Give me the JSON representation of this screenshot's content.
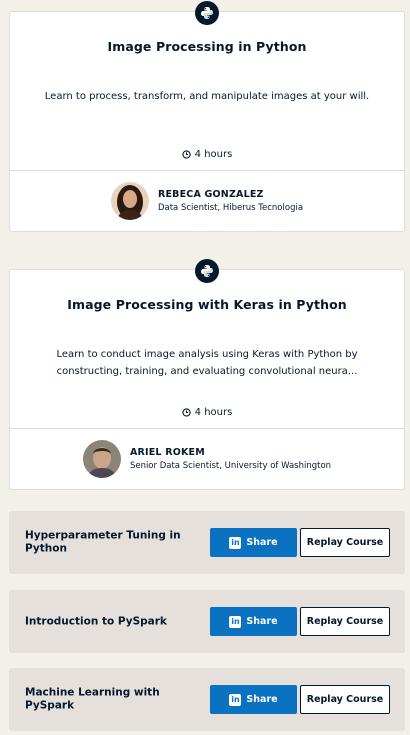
{
  "cards": [
    {
      "icon": "python-icon",
      "title": "Image Processing in Python",
      "description": "Learn to process, transform, and manipulate images at your will.",
      "duration": "4 hours",
      "author": {
        "name": "REBECA GONZALEZ",
        "title": "Data Scientist, Hiberus Tecnologia"
      }
    },
    {
      "icon": "python-icon",
      "title": "Image Processing with Keras in Python",
      "description": "Learn to conduct image analysis using Keras with Python by constructing, training, and evaluating convolutional neura...",
      "duration": "4 hours",
      "author": {
        "name": "ARIEL ROKEM",
        "title": "Senior Data Scientist, University of Washington"
      }
    }
  ],
  "completed": [
    {
      "title": "Hyperparameter Tuning in Python",
      "share_label": "Share",
      "replay_label": "Replay Course"
    },
    {
      "title": "Introduction to PySpark",
      "share_label": "Share",
      "replay_label": "Replay Course"
    },
    {
      "title": "Machine Learning with PySpark",
      "share_label": "Share",
      "replay_label": "Replay Course"
    }
  ],
  "colors": {
    "background": "#f3efe9",
    "navy": "#05192d",
    "linkedin_blue": "#0a72c0",
    "row_bg": "#e5e0db"
  },
  "icons": {
    "clock": "clock-icon",
    "linkedin": "linkedin-icon",
    "python": "python-icon"
  }
}
